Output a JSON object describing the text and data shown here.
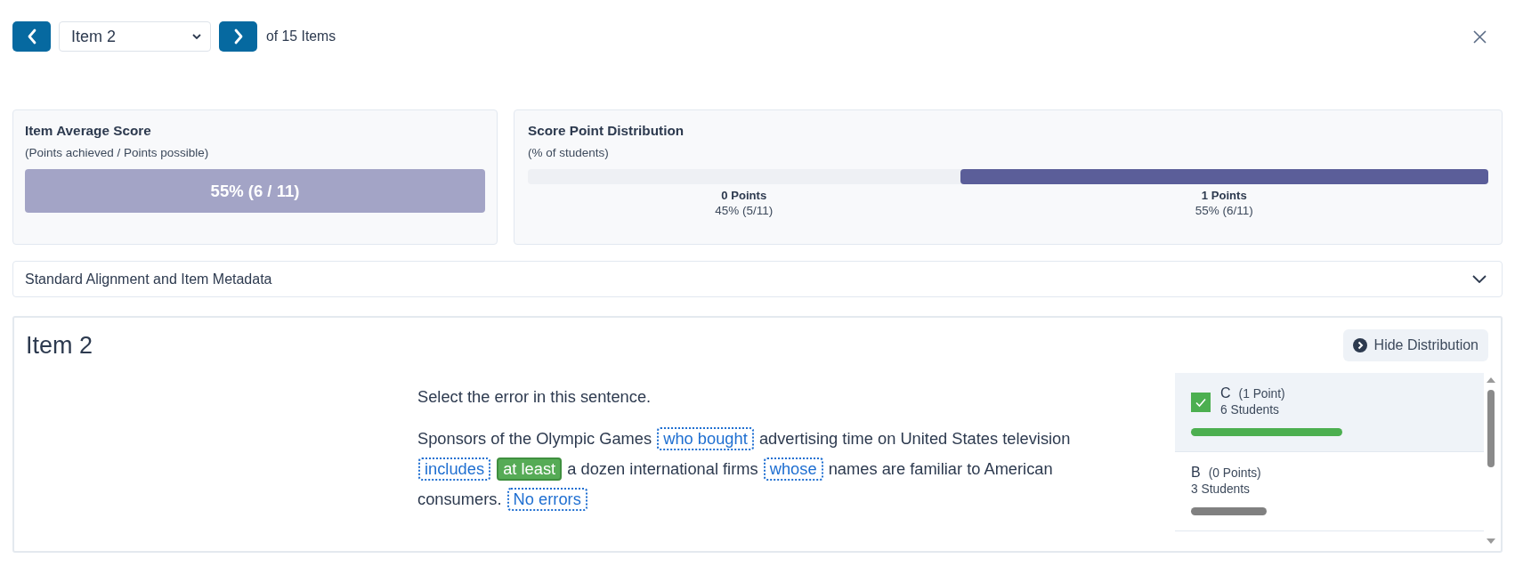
{
  "nav": {
    "item_select": {
      "value": "Item 2"
    },
    "count_label": "of 15 Items"
  },
  "average_score": {
    "title": "Item Average Score",
    "subtitle": "(Points achieved / Points possible)",
    "value": "55% (6 / 11)"
  },
  "score_distribution": {
    "title": "Score Point Distribution",
    "subtitle": "(% of students)",
    "level": 0.55,
    "columns": [
      {
        "label": "0 Points",
        "detail": "45% (5/11)"
      },
      {
        "label": "1 Points",
        "detail": "55% (6/11)"
      }
    ]
  },
  "metadata_section": {
    "title": "Standard Alignment and Item Metadata",
    "expanded": false
  },
  "item": {
    "title": "Item 2",
    "hide_button": "Hide Distribution",
    "prompt": "Select the error in this sentence.",
    "passage": [
      {
        "kind": "text",
        "text": "Sponsors of the Olympic Games"
      },
      {
        "kind": "choice",
        "text": "who bought",
        "selected": false
      },
      {
        "kind": "text",
        "text": "advertising time on United States television"
      },
      {
        "kind": "choice",
        "text": "includes",
        "selected": false
      },
      {
        "kind": "choice",
        "text": "at least",
        "selected": true
      },
      {
        "kind": "text",
        "text": "a dozen international firms"
      },
      {
        "kind": "choice",
        "text": "whose",
        "selected": false
      },
      {
        "kind": "text",
        "text": "names are familiar to American consumers."
      },
      {
        "kind": "choice",
        "text": "No errors",
        "selected": false
      }
    ],
    "distribution": [
      {
        "letter": "C",
        "points": "(1 Point)",
        "students": "6 Students",
        "level": 0.545,
        "correct": true
      },
      {
        "letter": "B",
        "points": "(0 Points)",
        "students": "3 Students",
        "level": 0.273,
        "correct": false
      }
    ]
  }
}
